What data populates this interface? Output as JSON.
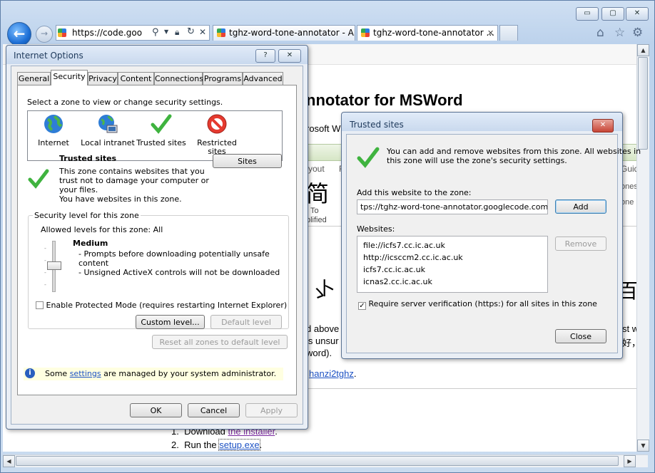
{
  "browser": {
    "address": "https://code.goo",
    "tabs": [
      {
        "label": "tghz-word-tone-annotator - A..."
      },
      {
        "label": "tghz-word-tone-annotator ..."
      }
    ],
    "window_buttons": {
      "minimize": "▭",
      "maximize": "▢",
      "close": "✕"
    }
  },
  "page": {
    "heading": "nnotator for MSWord",
    "sub": "rosoft W",
    "ribbon_frag_1": "yout",
    "ribbon_frag_2": "R",
    "right_frag_1": "Guid",
    "right_frag_2": "ones",
    "right_frag_3": "one",
    "chinese_char": "简",
    "to_label": "To",
    "simplified_label": "plified",
    "big_glyph_right": "百",
    "big_glyph_mid": "ゝ",
    "big_glyph_left": "卜",
    "para1": "d above",
    "para2": "is unsur",
    "para3": "word).",
    "para_right1": "st w",
    "para_right2": "好，",
    "link_hanzi": "hanzi2tghz",
    "link_hanzi_dot": ".",
    "steps": [
      {
        "num": "1.",
        "text": "Download ",
        "link": "the installer",
        "end": "."
      },
      {
        "num": "2.",
        "text": "Run the ",
        "link": "setup.exe",
        "end": "."
      }
    ]
  },
  "internet_options": {
    "title": "Internet Options",
    "help": "?",
    "close": "✕",
    "tabs": [
      "General",
      "Security",
      "Privacy",
      "Content",
      "Connections",
      "Programs",
      "Advanced"
    ],
    "active_tab": "Security",
    "zone_prompt": "Select a zone to view or change security settings.",
    "zones": [
      {
        "label": "Internet",
        "icon": "globe-icon"
      },
      {
        "label": "Local intranet",
        "icon": "intranet-icon"
      },
      {
        "label": "Trusted sites",
        "icon": "checkmark-icon"
      },
      {
        "label": "Restricted sites",
        "icon": "restricted-icon"
      }
    ],
    "zone_title": "Trusted sites",
    "zone_desc_1": "This zone contains websites that you",
    "zone_desc_2": "trust not to damage your computer or",
    "zone_desc_3": "your files.",
    "zone_desc_4": "You have websites in this zone.",
    "sites_button": "Sites",
    "security_level_group": "Security level for this zone",
    "allowed_levels": "Allowed levels for this zone: All",
    "level_name": "Medium",
    "level_bullets": [
      "- Prompts before downloading potentially unsafe",
      "content",
      "- Unsigned ActiveX controls will not be downloaded"
    ],
    "protected_mode": "Enable Protected Mode (requires restarting Internet Explorer)",
    "protected_mode_checked": false,
    "custom_level": "Custom level...",
    "default_level": "Default level",
    "reset_all": "Reset all zones to default level",
    "info_pre": "Some ",
    "info_link": "settings",
    "info_post": " are managed by your system administrator.",
    "ok": "OK",
    "cancel": "Cancel",
    "apply": "Apply"
  },
  "trusted_sites": {
    "title": "Trusted sites",
    "close": "✕",
    "intro_1": "You can add and remove websites from this zone. All websites in",
    "intro_2": "this zone will use the zone's security settings.",
    "add_label": "Add this website to the zone:",
    "add_value": "tps://tghz-word-tone-annotator.googlecode.com",
    "add_button": "Add",
    "websites_label": "Websites:",
    "websites": [
      "file://icfs7.cc.ic.ac.uk",
      "http://icsccm2.cc.ic.ac.uk",
      "icfs7.cc.ic.ac.uk",
      "icnas2.cc.ic.ac.uk"
    ],
    "remove_button": "Remove",
    "require_https": "Require server verification (https:) for all sites in this zone",
    "require_https_checked": true,
    "close_button": "Close"
  }
}
